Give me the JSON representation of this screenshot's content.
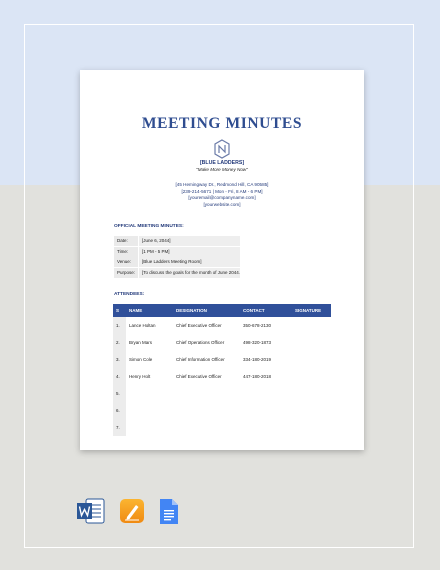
{
  "document": {
    "title": "MEETING MINUTES",
    "company": "[BLUE LADDERS]",
    "tagline": "\"Make More Money Now\"",
    "address_lines": [
      "[45 Hemingway Dr., Redmond Hill, CA 90585]",
      "[239-214-5671 | Mon - Fri, 8 AM - 6 PM]",
      "[youremail@companyname.com]",
      "[yourwebsite.com]"
    ],
    "official_heading": "OFFICIAL MEETING MINUTES:",
    "info": [
      {
        "label": "Date:",
        "value": "[June 6, 2044]"
      },
      {
        "label": "Time:",
        "value": "[1 PM - 5 PM]"
      },
      {
        "label": "Venue:",
        "value": "[Blue Ladders Meeting Room]"
      },
      {
        "label": "Purpose:",
        "value": "[To discuss the goals for the month of June 2044.]"
      }
    ],
    "attendees_heading": "ATTENDEES:",
    "attendee_columns": [
      "S No.",
      "NAME",
      "DESIGNATION",
      "CONTACT",
      "SIGNATURE"
    ],
    "attendees": [
      {
        "no": "1.",
        "name": "Lance Holtan",
        "designation": "Chief Executive Officer",
        "contact": "350-678-2130",
        "signature": ""
      },
      {
        "no": "2.",
        "name": "Bryan Mars",
        "designation": "Chief Operations Officer",
        "contact": "498-320-1873",
        "signature": ""
      },
      {
        "no": "3.",
        "name": "Simon Cole",
        "designation": "Chief Information Officer",
        "contact": "334-180-2019",
        "signature": ""
      },
      {
        "no": "4.",
        "name": "Henry Holt",
        "designation": "Chief Executive Officer",
        "contact": "447-180-2018",
        "signature": ""
      },
      {
        "no": "5.",
        "name": "",
        "designation": "",
        "contact": "",
        "signature": ""
      },
      {
        "no": "6.",
        "name": "",
        "designation": "",
        "contact": "",
        "signature": ""
      },
      {
        "no": "7.",
        "name": "",
        "designation": "",
        "contact": "",
        "signature": ""
      }
    ]
  },
  "format_icons": [
    {
      "icon": "word-icon",
      "color": "#2b5797"
    },
    {
      "icon": "pages-icon",
      "color": "#f7a01c"
    },
    {
      "icon": "google-docs-icon",
      "color": "#4285f4"
    }
  ],
  "colors": {
    "accent": "#30509a",
    "title": "#2f4d90",
    "bg_top": "#dbe5f5",
    "bg_bottom": "#e1e1dd"
  }
}
